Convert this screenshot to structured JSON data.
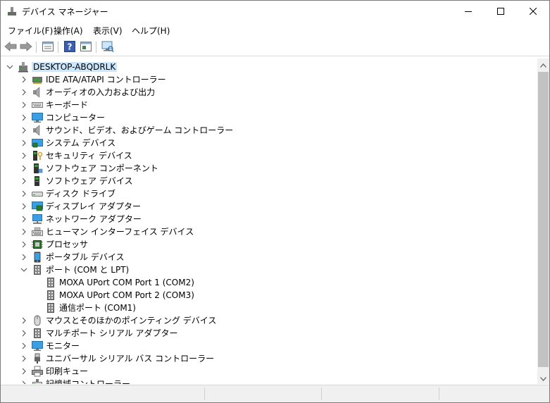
{
  "window": {
    "title": "デバイス マネージャー",
    "controls": [
      {
        "name": "minimize-icon"
      },
      {
        "name": "maximize-icon"
      },
      {
        "name": "close-icon"
      }
    ]
  },
  "menu": {
    "items": [
      "ファイル(F)",
      "操作(A)",
      "表示(V)",
      "ヘルプ(H)"
    ]
  },
  "toolbar": {
    "buttons": [
      "back-arrow-icon",
      "forward-arrow-icon",
      "properties-icon",
      "help-icon",
      "update-driver-icon",
      "scan-hardware-icon"
    ]
  },
  "tree": {
    "root": {
      "label": "DESKTOP-ABQDRLK",
      "icon": "computer-root-icon",
      "expanded": true,
      "selected": true
    },
    "items": [
      {
        "label": "IDE ATA/ATAPI コントローラー",
        "icon": "ide-controller-icon",
        "expanded": false
      },
      {
        "label": "オーディオの入力および出力",
        "icon": "speaker-icon",
        "expanded": false
      },
      {
        "label": "キーボード",
        "icon": "keyboard-icon",
        "expanded": false
      },
      {
        "label": "コンピューター",
        "icon": "monitor-icon",
        "expanded": false
      },
      {
        "label": "サウンド、ビデオ、およびゲーム コントローラー",
        "icon": "speaker-icon",
        "expanded": false
      },
      {
        "label": "システム デバイス",
        "icon": "system-device-icon",
        "expanded": false
      },
      {
        "label": "セキュリティ デバイス",
        "icon": "security-key-icon",
        "expanded": false
      },
      {
        "label": "ソフトウェア コンポーネント",
        "icon": "software-component-icon",
        "expanded": false
      },
      {
        "label": "ソフトウェア デバイス",
        "icon": "software-device-icon",
        "expanded": false
      },
      {
        "label": "ディスク ドライブ",
        "icon": "disk-drive-icon",
        "expanded": false
      },
      {
        "label": "ディスプレイ アダプター",
        "icon": "display-adapter-icon",
        "expanded": false
      },
      {
        "label": "ネットワーク アダプター",
        "icon": "network-adapter-icon",
        "expanded": false
      },
      {
        "label": "ヒューマン インターフェイス デバイス",
        "icon": "hid-icon",
        "expanded": false
      },
      {
        "label": "プロセッサ",
        "icon": "processor-icon",
        "expanded": false
      },
      {
        "label": "ポータブル デバイス",
        "icon": "portable-device-icon",
        "expanded": false
      },
      {
        "label": "ポート (COM と LPT)",
        "icon": "port-icon",
        "expanded": true,
        "children": [
          {
            "label": "MOXA UPort COM Port 1 (COM2)",
            "icon": "port-icon"
          },
          {
            "label": "MOXA UPort COM Port 2 (COM3)",
            "icon": "port-icon"
          },
          {
            "label": "通信ポート (COM1)",
            "icon": "port-icon"
          }
        ]
      },
      {
        "label": "マウスとそのほかのポインティング デバイス",
        "icon": "mouse-icon",
        "expanded": false
      },
      {
        "label": "マルチポート シリアル アダプター",
        "icon": "port-icon",
        "expanded": false
      },
      {
        "label": "モニター",
        "icon": "monitor-icon",
        "expanded": false
      },
      {
        "label": "ユニバーサル シリアル バス コントローラー",
        "icon": "usb-icon",
        "expanded": false
      },
      {
        "label": "印刷キュー",
        "icon": "printer-icon",
        "expanded": false
      },
      {
        "label": "記憶域コントローラー",
        "icon": "storage-controller-icon",
        "expanded": false
      }
    ]
  },
  "colors": {
    "selection": "#cce8ff",
    "scrollbar_track": "#f0f0f0",
    "scrollbar_thumb": "#c2c2c2",
    "statusbar": "#f0f0f0"
  }
}
